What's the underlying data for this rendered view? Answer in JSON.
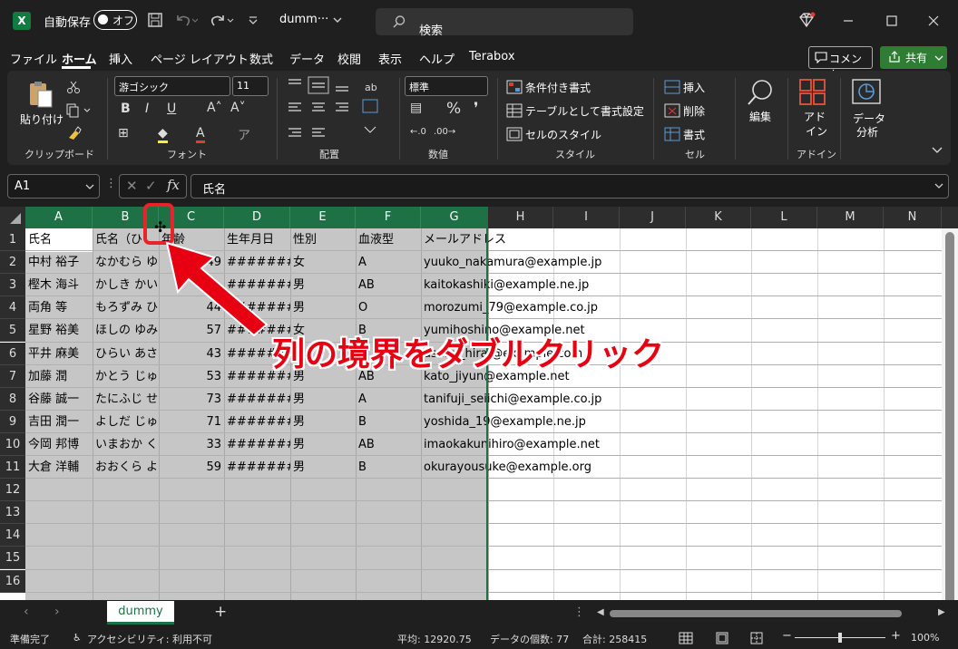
{
  "titlebar": {
    "app_icon": "X",
    "autosave_label": "自動保存",
    "autosave_state": "オフ",
    "filename": "dumm···",
    "search_placeholder": "検索"
  },
  "menu": {
    "items": [
      "ファイル",
      "ホーム",
      "挿入",
      "ページ レイアウト",
      "数式",
      "データ",
      "校閲",
      "表示",
      "ヘルプ",
      "Terabox"
    ],
    "active": "ホーム",
    "comment_label": "コメント",
    "share_label": "共有"
  },
  "ribbon": {
    "clipboard": {
      "paste": "貼り付け",
      "label": "クリップボード"
    },
    "font": {
      "name": "游ゴシック",
      "size": "11",
      "label": "フォント"
    },
    "align": {
      "label": "配置"
    },
    "number": {
      "format": "標準",
      "label": "数値"
    },
    "style": {
      "cond": "条件付き書式",
      "table": "テーブルとして書式設定",
      "cell": "セルのスタイル",
      "label": "スタイル"
    },
    "cells": {
      "insert": "挿入",
      "delete": "削除",
      "format": "書式",
      "label": "セル"
    },
    "edit": {
      "label": "編集"
    },
    "addin": {
      "label1": "アド",
      "label2": "イン",
      "label": "アドイン"
    },
    "analysis": {
      "label1": "データ",
      "label2": "分析"
    }
  },
  "formula": {
    "cell_ref": "A1",
    "value": "氏名"
  },
  "columns": [
    "A",
    "B",
    "C",
    "D",
    "E",
    "F",
    "G",
    "H",
    "I",
    "J",
    "K",
    "L",
    "M",
    "N"
  ],
  "rows": [
    "1",
    "2",
    "3",
    "4",
    "5",
    "6",
    "7",
    "8",
    "9",
    "10",
    "11",
    "12",
    "13",
    "14",
    "15",
    "16"
  ],
  "cells": [
    [
      "氏名",
      "氏名（ひ",
      "年齢",
      "生年月日",
      "性別",
      "血液型",
      "メールアドレス"
    ],
    [
      "中村 裕子",
      "なかむら ゆ",
      "49",
      "#######",
      "女",
      "A",
      "yuuko_nakamura@example.jp"
    ],
    [
      "樫木 海斗",
      "かしき かい",
      "",
      "#######",
      "男",
      "AB",
      "kaitokashiki@example.ne.jp"
    ],
    [
      "両角 等",
      "もろずみ ひ",
      "44",
      "#######",
      "男",
      "O",
      "morozumi_79@example.co.jp"
    ],
    [
      "星野 裕美",
      "ほしの ゆみ",
      "57",
      "#######",
      "女",
      "B",
      "yumihoshino@example.net"
    ],
    [
      "平井 麻美",
      "ひらい あさ",
      "43",
      "#######",
      "女",
      "B",
      "asami_hirai@example.com"
    ],
    [
      "加藤 潤",
      "かとう じゅ",
      "53",
      "#######",
      "男",
      "AB",
      "kato_jiyun@example.net"
    ],
    [
      "谷藤 誠一",
      "たにふじ せ",
      "73",
      "#######",
      "男",
      "A",
      "tanifuji_seiichi@example.co.jp"
    ],
    [
      "吉田 潤一",
      "よしだ じゅ",
      "71",
      "#######",
      "男",
      "B",
      "yoshida_19@example.ne.jp"
    ],
    [
      "今岡 邦博",
      "いまおか く",
      "33",
      "#######",
      "男",
      "AB",
      "imaokakunihiro@example.net"
    ],
    [
      "大倉 洋輔",
      "おおくら よ",
      "59",
      "#######",
      "男",
      "B",
      "okurayousuke@example.org"
    ]
  ],
  "annotation": "列の境界をダブルクリック",
  "sheet": {
    "tab": "dummy",
    "add": "+"
  },
  "status": {
    "ready": "準備完了",
    "accessibility": "アクセシビリティ: 利用不可",
    "average": "平均: 12920.75",
    "count": "データの個数: 77",
    "sum": "合計: 258415",
    "zoom": "100%"
  }
}
